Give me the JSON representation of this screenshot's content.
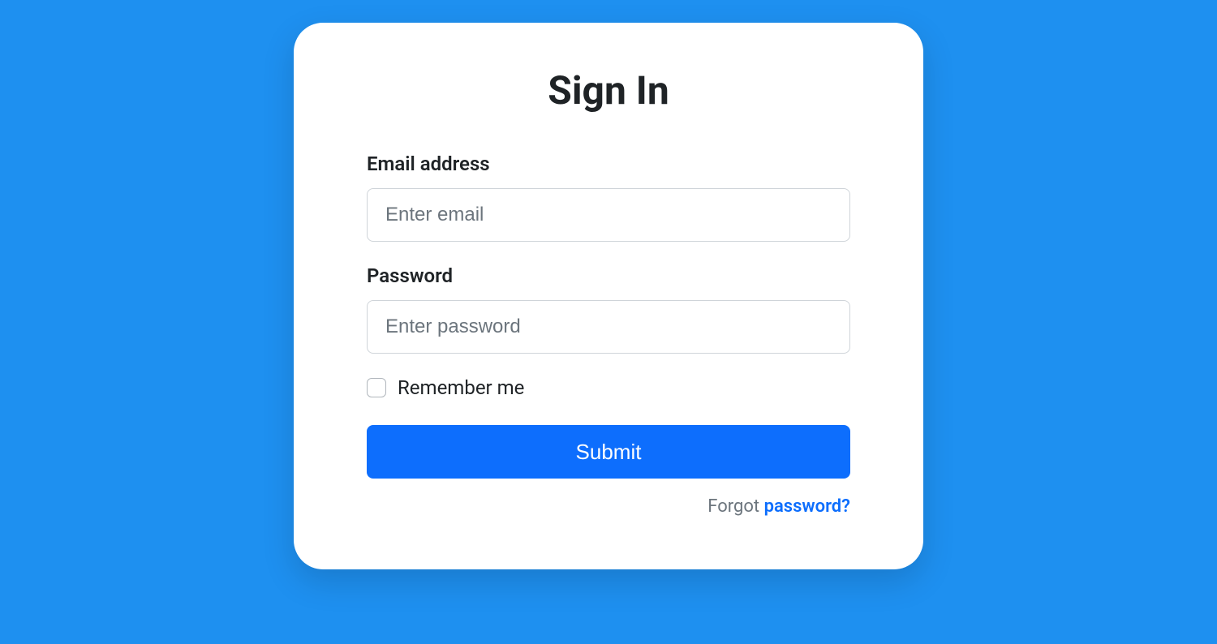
{
  "card": {
    "title": "Sign In",
    "email": {
      "label": "Email address",
      "placeholder": "Enter email",
      "value": ""
    },
    "password": {
      "label": "Password",
      "placeholder": "Enter password",
      "value": ""
    },
    "remember": {
      "label": "Remember me",
      "checked": false
    },
    "submit_label": "Submit",
    "forgot": {
      "prefix": "Forgot ",
      "link_text": "password?"
    }
  },
  "colors": {
    "background": "#1e90f0",
    "card_bg": "#ffffff",
    "primary": "#0d6efd",
    "text": "#1f2326",
    "muted": "#6c757d",
    "border": "#cfd4d9"
  }
}
